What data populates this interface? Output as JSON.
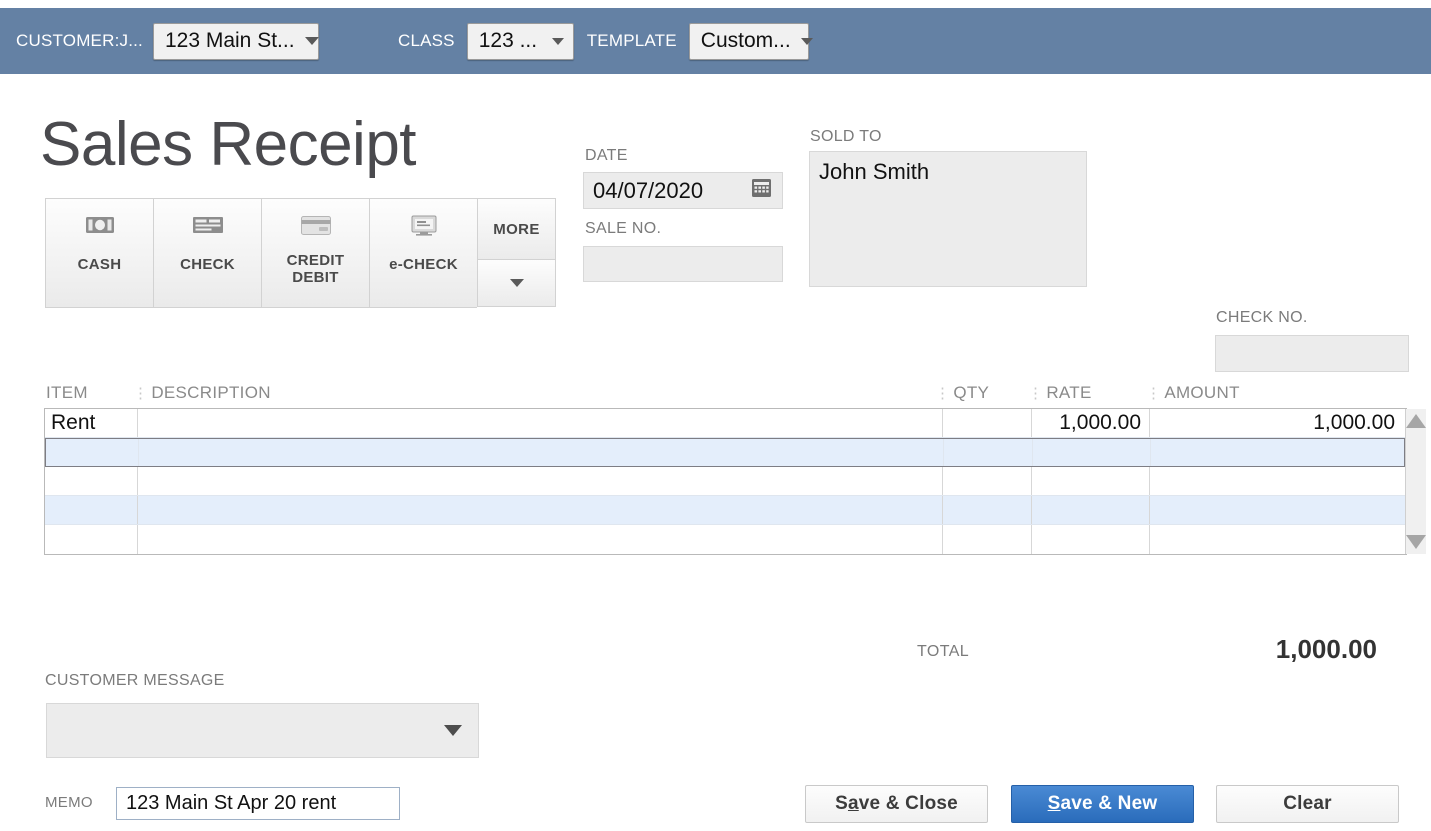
{
  "header": {
    "customer_label": "CUSTOMER:J...",
    "customer_value": "123 Main St...",
    "class_label": "CLASS",
    "class_value": "123 ...",
    "template_label": "TEMPLATE",
    "template_value": "Custom...",
    "bar_color": "#6481a4"
  },
  "title": "Sales Receipt",
  "payment_methods": [
    {
      "label": "CASH",
      "icon": "cash-banknote-icon"
    },
    {
      "label": "CHECK",
      "icon": "check-paper-icon"
    },
    {
      "label_line1": "CREDIT",
      "label_line2": "DEBIT",
      "icon": "credit-card-icon"
    },
    {
      "label": "e-CHECK",
      "icon": "e-check-monitor-icon"
    }
  ],
  "more_button": {
    "label": "MORE",
    "caret_icon": "chevron-down-icon"
  },
  "fields": {
    "date_label": "DATE",
    "date_value": "04/07/2020",
    "date_icon": "calendar-icon",
    "sale_no_label": "SALE NO.",
    "sale_no_value": "",
    "sold_to_label": "SOLD TO",
    "sold_to_value": "John Smith",
    "check_no_label": "CHECK NO.",
    "check_no_value": ""
  },
  "line_items": {
    "columns": [
      "ITEM",
      "DESCRIPTION",
      "QTY",
      "RATE",
      "AMOUNT"
    ],
    "rows": [
      {
        "item": "Rent",
        "description": "",
        "qty": "",
        "rate": "1,000.00",
        "amount": "1,000.00",
        "selected": false
      },
      {
        "item": "",
        "description": "",
        "qty": "",
        "rate": "",
        "amount": "",
        "selected": true
      },
      {
        "item": "",
        "description": "",
        "qty": "",
        "rate": "",
        "amount": "",
        "selected": false
      },
      {
        "item": "",
        "description": "",
        "qty": "",
        "rate": "",
        "amount": "",
        "selected": false
      },
      {
        "item": "",
        "description": "",
        "qty": "",
        "rate": "",
        "amount": "",
        "selected": false
      }
    ],
    "scroll_up_icon": "scroll-up-arrow-icon",
    "scroll_down_icon": "scroll-down-arrow-icon"
  },
  "totals": {
    "total_label": "TOTAL",
    "total_value": "1,000.00"
  },
  "footer": {
    "customer_message_label": "CUSTOMER MESSAGE",
    "customer_message_value": "",
    "memo_label": "MEMO",
    "memo_value": "123 Main St Apr 20 rent"
  },
  "actions": {
    "save_close": {
      "pre": "S",
      "accel": "a",
      "post": "ve & Close"
    },
    "save_new": {
      "pre": "",
      "accel": "S",
      "post": "ave & New"
    },
    "clear": {
      "label": "Clear"
    }
  }
}
